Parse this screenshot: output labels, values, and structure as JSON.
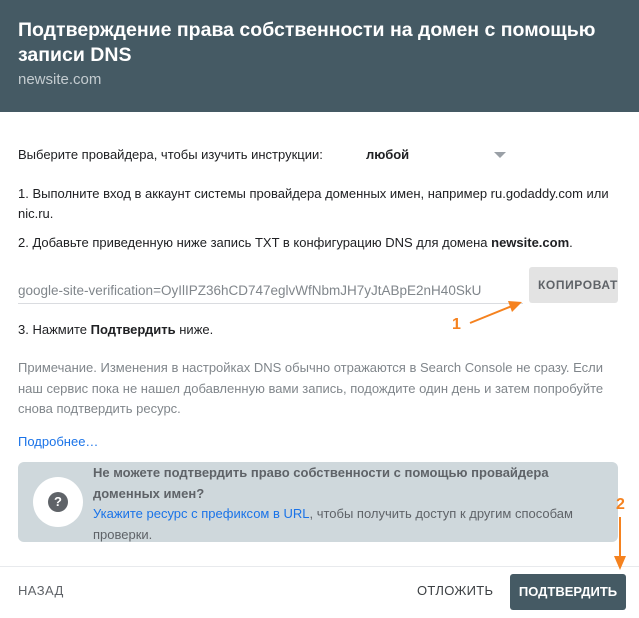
{
  "header": {
    "title": "Подтверждение права собственности на домен с помощью записи DNS",
    "domain": "newsite.com"
  },
  "provider": {
    "label": "Выберите провайдера, чтобы изучить инструкции:",
    "selected": "любой"
  },
  "steps": {
    "step1": "1. Выполните вход в аккаунт системы провайдера доменных имен, например ru.godaddy.com или nic.ru.",
    "step2_prefix": "2. Добавьте приведенную ниже запись TXT в конфигурацию DNS для домена ",
    "step2_domain": "newsite.com",
    "step2_suffix": ".",
    "step3_prefix": "3. Нажмите ",
    "step3_bold": "Подтвердить",
    "step3_suffix": " ниже."
  },
  "record": {
    "value": "google-site-verification=OyIlIPZ36hCD747eglvWfNbmJH7yJtABpE2nH40SkU",
    "copy_label": "КОПИРОВАТЬ"
  },
  "note": "Примечание. Изменения в настройках DNS обычно отражаются в Search Console не сразу. Если наш сервис пока не нашел добавленную вами запись, подождите один день и затем попробуйте снова подтвердить ресурс.",
  "more_link": "Подробнее…",
  "info": {
    "icon": "help-icon",
    "question": "Не можете подтвердить право собственности с помощью провайдера доменных имен?",
    "link": "Укажите ресурс с префиксом в URL",
    "rest": ", чтобы получить доступ к другим способам проверки."
  },
  "footer": {
    "back": "НАЗАД",
    "later": "ОТЛОЖИТЬ",
    "confirm": "ПОДТВЕРДИТЬ"
  },
  "annotations": {
    "one": "1",
    "two": "2",
    "color": "#f5821f"
  },
  "colors": {
    "header_bg": "#455a64",
    "link": "#1a73e8",
    "info_bg": "#cfd8dc"
  }
}
